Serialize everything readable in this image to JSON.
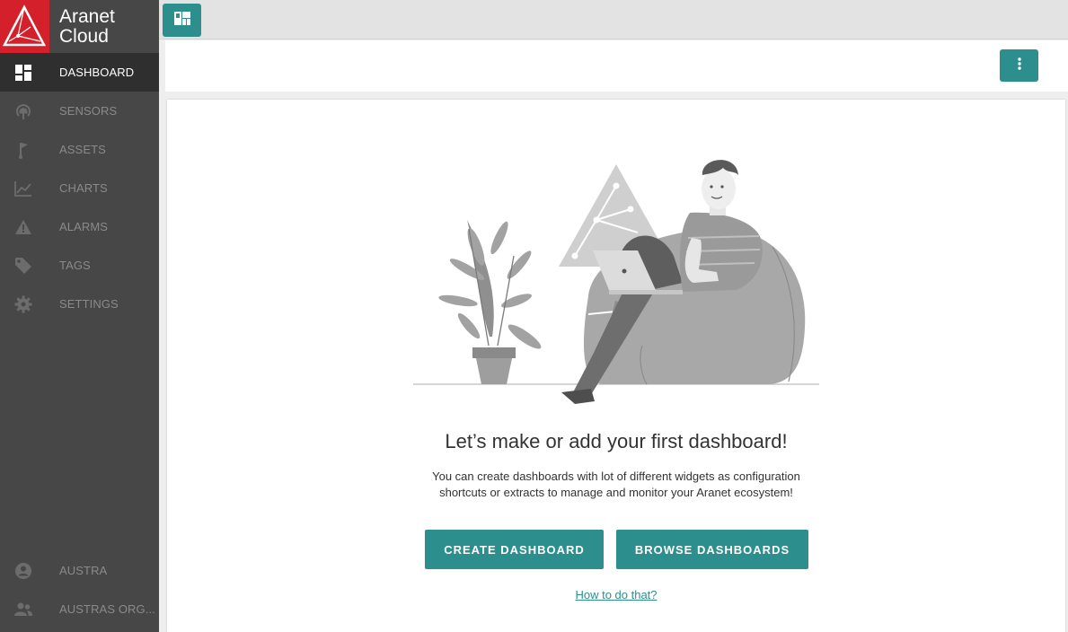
{
  "brand": {
    "title_line1": "Aranet",
    "title_line2": "Cloud"
  },
  "sidebar": {
    "items": [
      {
        "label": "DASHBOARD",
        "icon": "dashboard-icon",
        "active": true
      },
      {
        "label": "SENSORS",
        "icon": "sensor-icon"
      },
      {
        "label": "ASSETS",
        "icon": "flag-icon"
      },
      {
        "label": "CHARTS",
        "icon": "chart-icon"
      },
      {
        "label": "ALARMS",
        "icon": "warning-icon"
      },
      {
        "label": "TAGS",
        "icon": "tag-icon"
      },
      {
        "label": "SETTINGS",
        "icon": "gear-icon"
      }
    ],
    "bottom": [
      {
        "label": "AUSTRA",
        "icon": "user-icon"
      },
      {
        "label": "AUSTRAS ORG...",
        "icon": "group-icon"
      }
    ]
  },
  "empty_state": {
    "headline": "Let’s make or add your first dashboard!",
    "description": "You can create dashboards with lot of different widgets as configuration shortcuts or extracts to manage and monitor your Aranet ecosystem!",
    "create_label": "CREATE DASHBOARD",
    "browse_label": "BROWSE DASHBOARDS",
    "howto_label": "How to do that?"
  },
  "colors": {
    "accent": "#2c8f8e",
    "brand_red": "#d4202a",
    "sidebar": "#474747"
  }
}
